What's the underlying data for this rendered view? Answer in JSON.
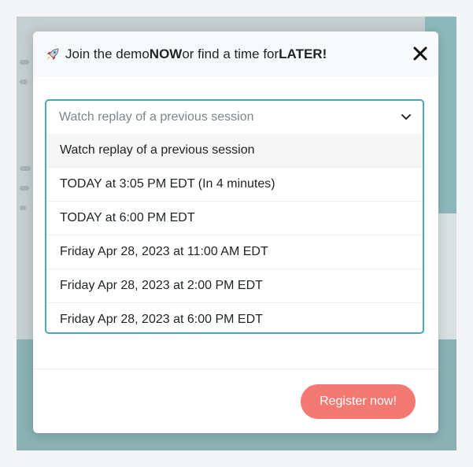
{
  "modal": {
    "title_before": "Join the demo ",
    "title_now": "NOW",
    "title_middle": " or find a time for ",
    "title_later": "LATER!",
    "close_label": "✕"
  },
  "session_select": {
    "selected_value": "Watch replay of a previous session",
    "options": [
      "Watch replay of a previous session",
      "TODAY at 3:05 PM EDT (In 4 minutes)",
      "TODAY at 6:00 PM EDT",
      "Friday Apr 28, 2023 at 11:00 AM EDT",
      "Friday Apr 28, 2023 at 2:00 PM EDT",
      "Friday Apr 28, 2023 at 6:00 PM EDT"
    ]
  },
  "footer": {
    "register_label": "Register now!"
  },
  "colors": {
    "accent": "#4ea6b3",
    "register_button": "#f47972"
  }
}
